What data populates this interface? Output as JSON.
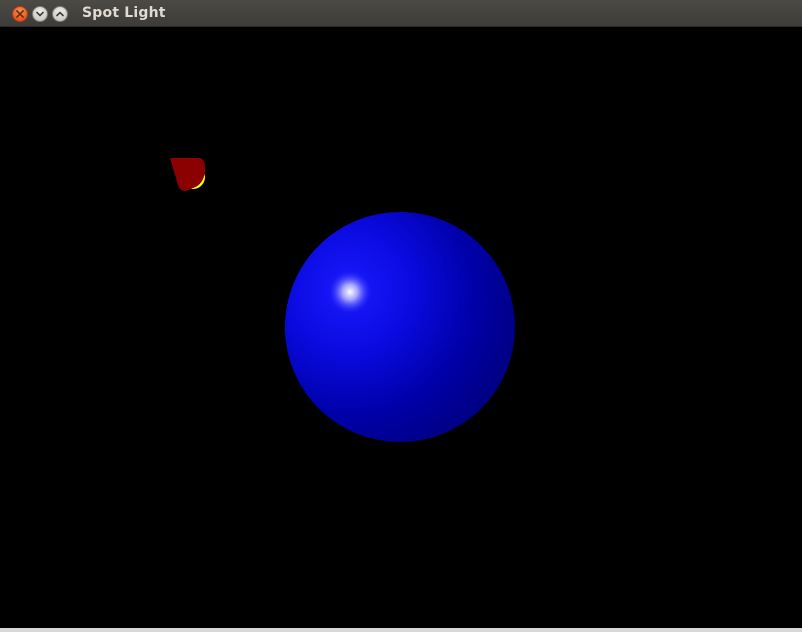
{
  "window": {
    "title": "Spot Light",
    "controls": [
      "close",
      "minimize",
      "maximize"
    ]
  },
  "scene": {
    "background": "#000000",
    "sphere_color": "#0000ff",
    "highlight_color": "#ffffff",
    "spotlight_body_color": "#8b0000",
    "spotlight_lens_color": "#ffff00"
  }
}
